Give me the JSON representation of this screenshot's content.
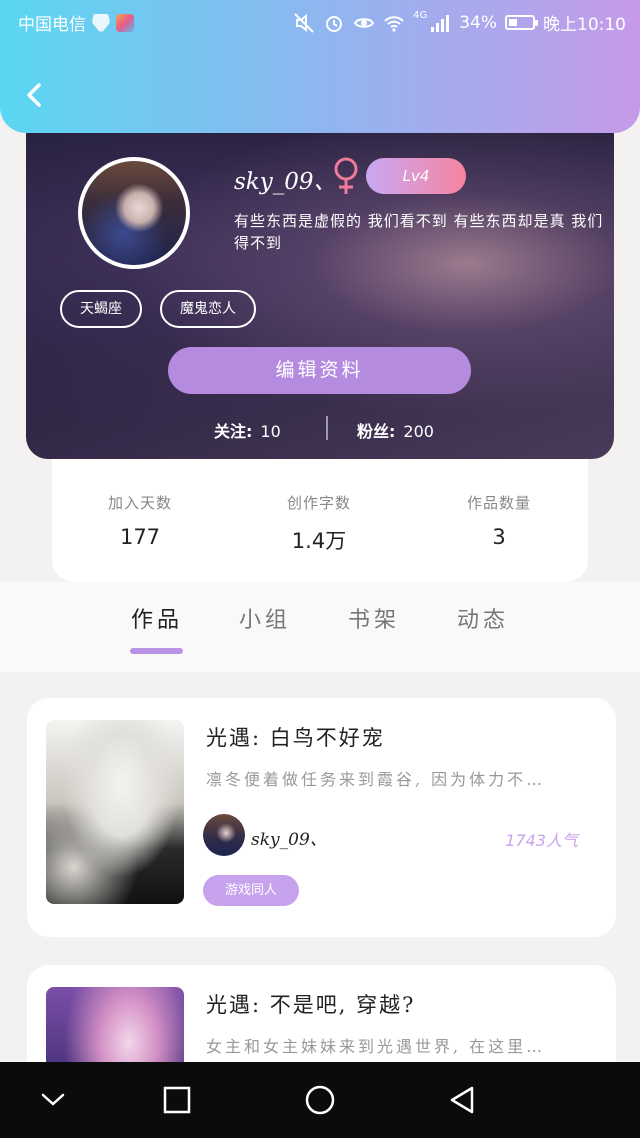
{
  "status_bar": {
    "carrier": "中国电信",
    "network": "4G",
    "battery": "34%",
    "time": "晚上10:10",
    "icons": [
      "mute-icon",
      "alarm-icon",
      "eye-comfort-icon",
      "wifi-icon",
      "signal-icon",
      "battery-icon"
    ]
  },
  "header": {
    "back_icon": "chevron-left-icon",
    "gradient": [
      "#5ad7f2",
      "#c69ae8"
    ]
  },
  "profile": {
    "username": "sky_09、",
    "gender": "female",
    "level": "Lv4",
    "bio": "有些东西是虚假的 我们看不到 有些东西却是真 我们得不到",
    "tags": [
      "天蝎座",
      "魔鬼恋人"
    ],
    "edit_button": "编辑资料",
    "following_label": "关注:",
    "following_count": "10",
    "followers_label": "粉丝:",
    "followers_count": "200"
  },
  "stats": [
    {
      "label": "加入天数",
      "value": "177"
    },
    {
      "label": "创作字数",
      "value": "1.4万"
    },
    {
      "label": "作品数量",
      "value": "3"
    }
  ],
  "tabs": [
    {
      "label": "作品",
      "active": true
    },
    {
      "label": "小组",
      "active": false
    },
    {
      "label": "书架",
      "active": false
    },
    {
      "label": "动态",
      "active": false
    }
  ],
  "works": [
    {
      "title": "光遇: 白鸟不好宠",
      "description": "凛冬便着做任务来到霞谷, 因为体力不…",
      "author": "sky_09、",
      "popularity": "1743人气",
      "genre": "游戏同人"
    },
    {
      "title": "光遇: 不是吧, 穿越?",
      "description": "女主和女主妹妹来到光遇世界, 在这里…"
    }
  ],
  "colors": {
    "accent": "#b58be0",
    "tab_underline": "#b993e6",
    "popularity": "#c8a3ec",
    "genre_tag": "#c7a3ee"
  },
  "nav_icons": [
    "collapse-chevron-icon",
    "recents-square-icon",
    "home-circle-icon",
    "back-triangle-icon"
  ]
}
